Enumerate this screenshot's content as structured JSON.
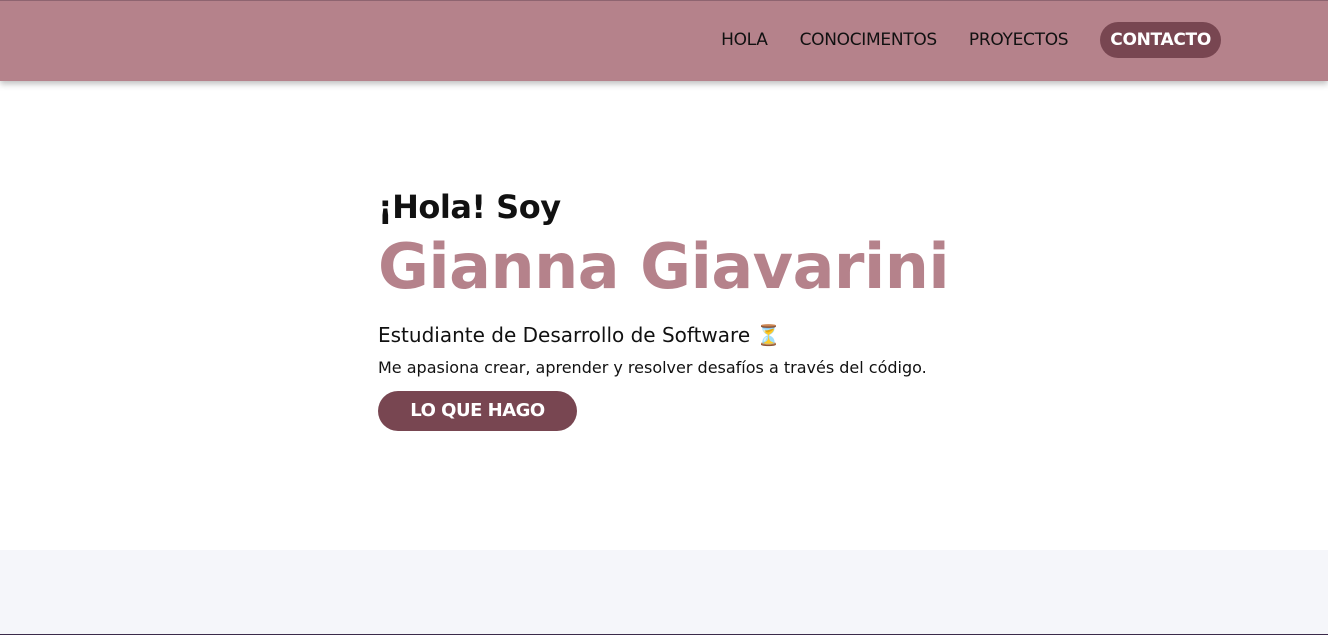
{
  "nav": {
    "links": [
      {
        "label": "HOLA"
      },
      {
        "label": "CONOCIMENTOS"
      },
      {
        "label": "PROYECTOS"
      },
      {
        "label": "CONTACTO",
        "active": true
      }
    ]
  },
  "hero": {
    "greeting": "¡Hola! Soy",
    "name": "Gianna Giavarini",
    "role": "Estudiante de Desarrollo de Software",
    "role_emoji": "⏳",
    "tagline": "Me apasiona crear, aprender y resolver desafíos a través del código.",
    "cta_label": "LO QUE HAGO"
  },
  "colors": {
    "nav_background": "#b5828b",
    "accent_dark": "#784651",
    "name_color": "#b5828b",
    "next_section_background": "#f5f6fa"
  }
}
